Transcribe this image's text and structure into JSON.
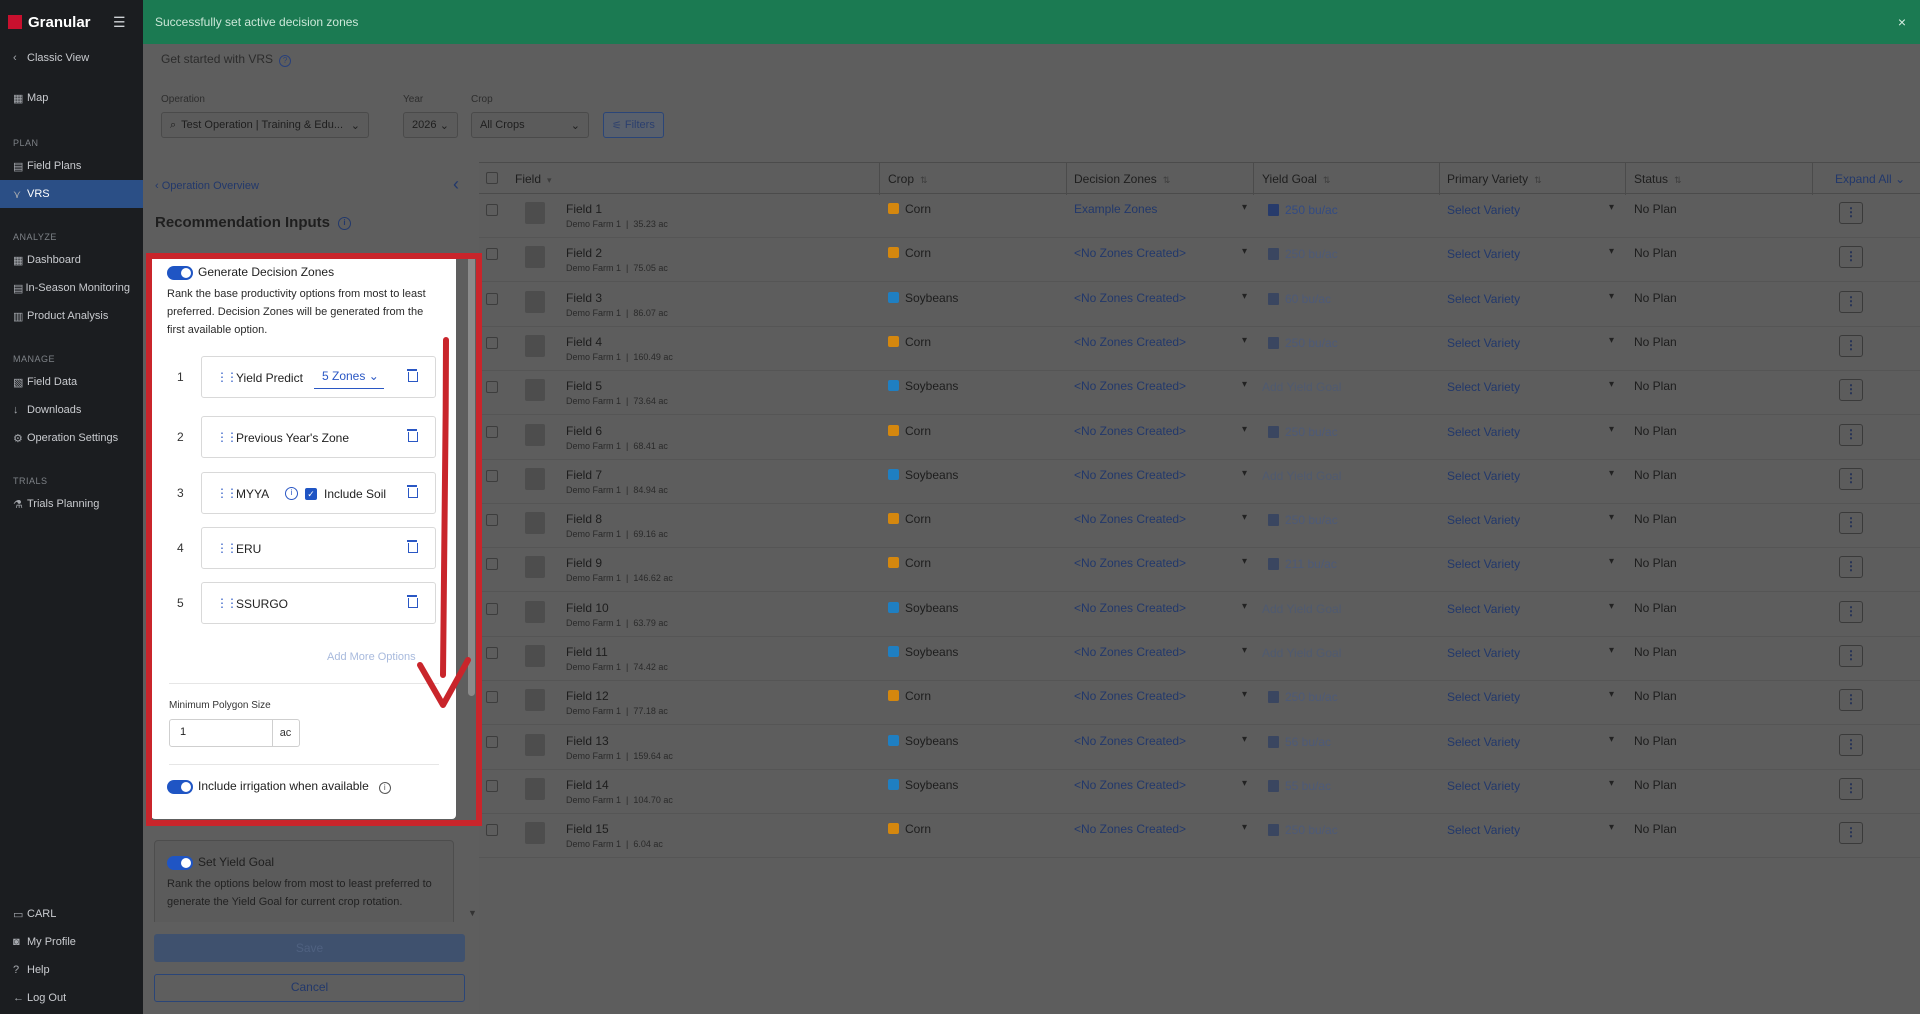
{
  "toast": {
    "message": "Successfully set active decision zones",
    "close": "×"
  },
  "brand": {
    "name": "Granular"
  },
  "sidebar": {
    "classic_view": "Classic View",
    "map": "Map",
    "sections": {
      "plan": "PLAN",
      "analyze": "ANALYZE",
      "manage": "MANAGE",
      "trials": "TRIALS"
    },
    "plan_items": [
      "Field Plans",
      "VRS"
    ],
    "analyze_items": [
      "Dashboard",
      "In-Season Monitoring",
      "Product Analysis"
    ],
    "manage_items": [
      "Field Data",
      "Downloads",
      "Operation Settings"
    ],
    "trials_items": [
      "Trials Planning"
    ],
    "bottom_items": [
      "CARL",
      "My Profile",
      "Help",
      "Log Out"
    ]
  },
  "header": {
    "get_started": "Get started with VRS",
    "operation_label": "Operation",
    "operation_value": "Test Operation | Training & Edu...",
    "year_label": "Year",
    "year_value": "2026",
    "crop_label": "Crop",
    "crop_value": "All Crops",
    "filters": "Filters"
  },
  "panel": {
    "back": "Operation Overview",
    "title": "Recommendation Inputs",
    "decision_zones": {
      "title": "Generate Decision Zones",
      "enabled": true,
      "description": "Rank the base productivity options from most to least preferred. Decision Zones will be generated from the first available option.",
      "options": [
        {
          "num": "1",
          "label": "Yield Predict",
          "zones": "5 Zones"
        },
        {
          "num": "2",
          "label": "Previous Year's Zone"
        },
        {
          "num": "3",
          "label": "MYYA",
          "checkbox_label": "Include Soil",
          "checked": true
        },
        {
          "num": "4",
          "label": "ERU"
        },
        {
          "num": "5",
          "label": "SSURGO"
        }
      ],
      "add_more": "Add More Options",
      "min_polygon_label": "Minimum Polygon Size",
      "min_polygon_value": "1",
      "min_polygon_unit": "ac",
      "irrigation": "Include irrigation when available",
      "irrigation_enabled": true
    },
    "yield_goal": {
      "title": "Set Yield Goal",
      "enabled": true,
      "description": "Rank the options below from most to least preferred to generate the Yield Goal for current crop rotation."
    },
    "save": "Save",
    "cancel": "Cancel"
  },
  "table": {
    "headers": {
      "field": "Field",
      "crop": "Crop",
      "zones": "Decision Zones",
      "yield": "Yield Goal",
      "variety": "Primary Variety",
      "status": "Status",
      "expand": "Expand All"
    },
    "rows": [
      {
        "name": "Field 1",
        "farm": "Demo Farm 1",
        "acres": "35.23 ac",
        "crop": "Corn",
        "zones": "Example Zones",
        "yield": "250 bu/ac",
        "variety": "Select Variety",
        "status": "No Plan"
      },
      {
        "name": "Field 2",
        "farm": "Demo Farm 1",
        "acres": "75.05 ac",
        "crop": "Corn",
        "zones": "<No Zones Created>",
        "yield": "250 bu/ac",
        "variety": "Select Variety",
        "status": "No Plan"
      },
      {
        "name": "Field 3",
        "farm": "Demo Farm 1",
        "acres": "86.07 ac",
        "crop": "Soybeans",
        "zones": "<No Zones Created>",
        "yield": "60 bu/ac",
        "variety": "Select Variety",
        "status": "No Plan"
      },
      {
        "name": "Field 4",
        "farm": "Demo Farm 1",
        "acres": "160.49 ac",
        "crop": "Corn",
        "zones": "<No Zones Created>",
        "yield": "250 bu/ac",
        "variety": "Select Variety",
        "status": "No Plan"
      },
      {
        "name": "Field 5",
        "farm": "Demo Farm 1",
        "acres": "73.64 ac",
        "crop": "Soybeans",
        "zones": "<No Zones Created>",
        "yield": "Add Yield Goal",
        "variety": "Select Variety",
        "status": "No Plan"
      },
      {
        "name": "Field 6",
        "farm": "Demo Farm 1",
        "acres": "68.41 ac",
        "crop": "Corn",
        "zones": "<No Zones Created>",
        "yield": "250 bu/ac",
        "variety": "Select Variety",
        "status": "No Plan"
      },
      {
        "name": "Field 7",
        "farm": "Demo Farm 1",
        "acres": "84.94 ac",
        "crop": "Soybeans",
        "zones": "<No Zones Created>",
        "yield": "Add Yield Goal",
        "variety": "Select Variety",
        "status": "No Plan"
      },
      {
        "name": "Field 8",
        "farm": "Demo Farm 1",
        "acres": "69.16 ac",
        "crop": "Corn",
        "zones": "<No Zones Created>",
        "yield": "250 bu/ac",
        "variety": "Select Variety",
        "status": "No Plan"
      },
      {
        "name": "Field 9",
        "farm": "Demo Farm 1",
        "acres": "146.62 ac",
        "crop": "Corn",
        "zones": "<No Zones Created>",
        "yield": "211 bu/ac",
        "variety": "Select Variety",
        "status": "No Plan"
      },
      {
        "name": "Field 10",
        "farm": "Demo Farm 1",
        "acres": "63.79 ac",
        "crop": "Soybeans",
        "zones": "<No Zones Created>",
        "yield": "Add Yield Goal",
        "variety": "Select Variety",
        "status": "No Plan"
      },
      {
        "name": "Field 11",
        "farm": "Demo Farm 1",
        "acres": "74.42 ac",
        "crop": "Soybeans",
        "zones": "<No Zones Created>",
        "yield": "Add Yield Goal",
        "variety": "Select Variety",
        "status": "No Plan"
      },
      {
        "name": "Field 12",
        "farm": "Demo Farm 1",
        "acres": "77.18 ac",
        "crop": "Corn",
        "zones": "<No Zones Created>",
        "yield": "250 bu/ac",
        "variety": "Select Variety",
        "status": "No Plan"
      },
      {
        "name": "Field 13",
        "farm": "Demo Farm 1",
        "acres": "159.64 ac",
        "crop": "Soybeans",
        "zones": "<No Zones Created>",
        "yield": "56 bu/ac",
        "variety": "Select Variety",
        "status": "No Plan"
      },
      {
        "name": "Field 14",
        "farm": "Demo Farm 1",
        "acres": "104.70 ac",
        "crop": "Soybeans",
        "zones": "<No Zones Created>",
        "yield": "55 bu/ac",
        "variety": "Select Variety",
        "status": "No Plan"
      },
      {
        "name": "Field 15",
        "farm": "Demo Farm 1",
        "acres": "6.04 ac",
        "crop": "Corn",
        "zones": "<No Zones Created>",
        "yield": "250 bu/ac",
        "variety": "Select Variety",
        "status": "No Plan"
      }
    ]
  },
  "colors": {
    "corn": "#d4870e",
    "soybeans": "#1f7fc2",
    "toast": "#1b7a52",
    "accent": "#1f55c4",
    "highlight": "#c9252b"
  }
}
